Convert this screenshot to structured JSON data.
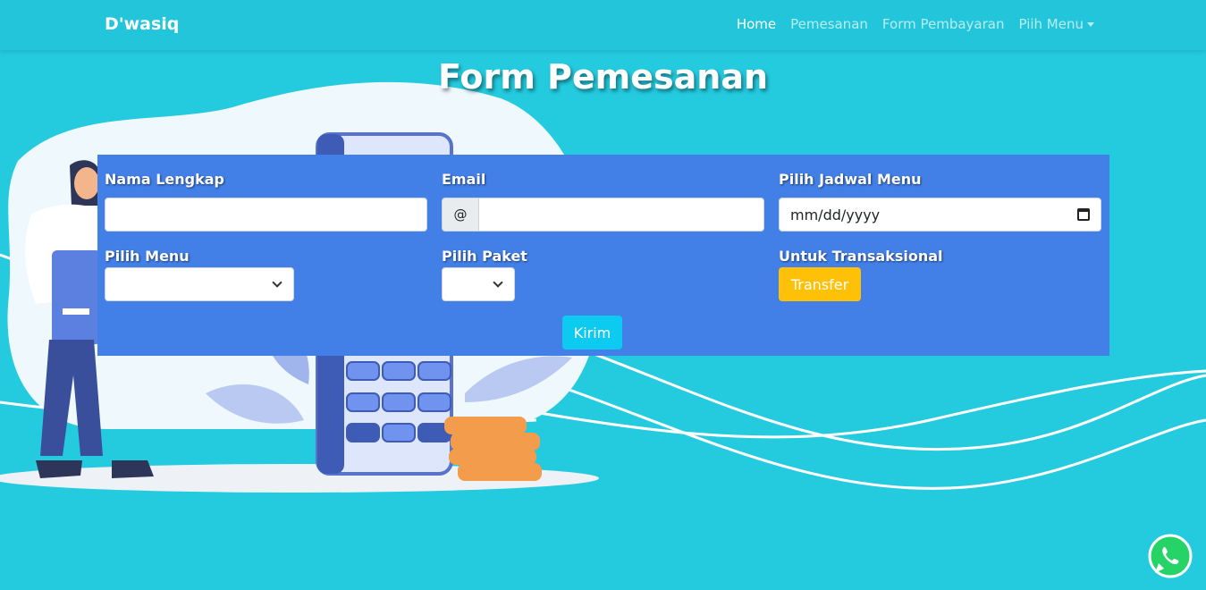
{
  "navbar": {
    "brand": "D'wasiq",
    "links": [
      {
        "label": "Home",
        "active": true
      },
      {
        "label": "Pemesanan",
        "active": false
      },
      {
        "label": "Form Pembayaran",
        "active": false
      },
      {
        "label": "Piih Menu",
        "active": false,
        "dropdown": true
      }
    ]
  },
  "page_title": "Form Pemesanan",
  "form": {
    "fields": {
      "nama": {
        "label": "Nama Lengkap",
        "value": ""
      },
      "email": {
        "label": "Email",
        "prefix": "@",
        "value": ""
      },
      "jadwal": {
        "label": "Pilih Jadwal Menu",
        "placeholder": "mm/dd/yyyy"
      },
      "menu": {
        "label": "Pilih Menu",
        "selected": ""
      },
      "paket": {
        "label": "Pilih Paket",
        "selected": ""
      },
      "transaksi": {
        "label": "Untuk Transaksional",
        "button": "Transfer"
      }
    },
    "submit": "Kirim"
  },
  "colors": {
    "background": "#24cbdf",
    "form_card": "#4280e8",
    "transfer_button": "#ffc107",
    "submit_button": "#0dcaf0"
  },
  "icons": {
    "whatsapp": "whatsapp-icon",
    "calendar": "calendar-icon"
  }
}
